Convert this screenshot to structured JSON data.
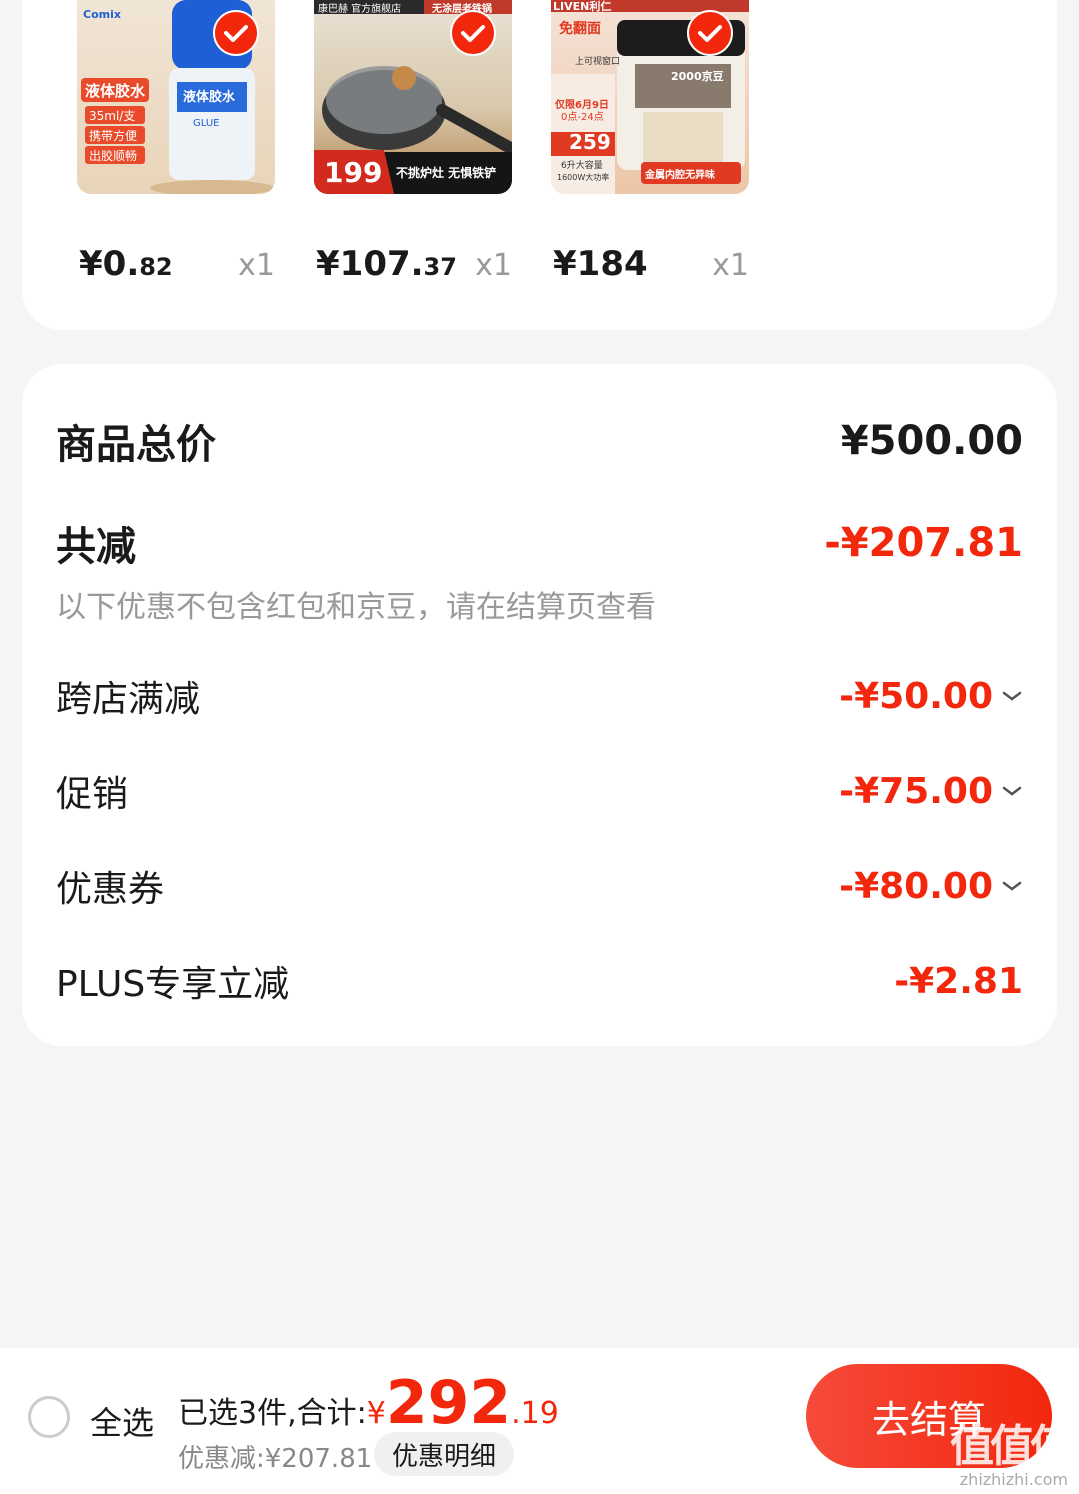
{
  "products": [
    {
      "name": "liquid-glue",
      "thumb_texts": [
        "Comix",
        "液体胶水",
        "35ml/支",
        "携带方便",
        "出胶顺畅",
        "液体胶水",
        "GLUE"
      ],
      "price_int": "¥0.",
      "price_dec": "82",
      "qty": "x1"
    },
    {
      "name": "wok",
      "thumb_texts": [
        "康巴赫 官方旗舰店",
        "无涂层老铁锅",
        "199",
        "不挑炉灶 无惧铁铲"
      ],
      "price_int": "¥107.",
      "price_dec": "37",
      "qty": "x1"
    },
    {
      "name": "air-fryer",
      "thumb_texts": [
        "LIVEN利仁",
        "免翻面",
        "上可视窗口",
        "仅限6月9日",
        "0点-24点",
        "259",
        "2000京豆",
        "6升大容量",
        "1600W大功率",
        "金属内腔无异味"
      ],
      "price_int": "¥184",
      "price_dec": "",
      "qty": "x1"
    }
  ],
  "summary": {
    "total_label": "商品总价",
    "total_value": "¥500.00",
    "discount_label": "共减",
    "discount_value": "-¥207.81",
    "note": "以下优惠不包含红包和京豆，请在结算页查看",
    "items": [
      {
        "label": "跨店满减",
        "value": "-¥50.00",
        "expandable": true
      },
      {
        "label": "促销",
        "value": "-¥75.00",
        "expandable": true
      },
      {
        "label": "优惠券",
        "value": "-¥80.00",
        "expandable": true
      },
      {
        "label": "PLUS专享立减",
        "value": "-¥2.81",
        "expandable": false
      }
    ]
  },
  "bottom_bar": {
    "select_all": "全选",
    "selected_text": "已选3件,合计:",
    "currency": "¥",
    "total_int": "292",
    "total_dec": ".19",
    "discount_text": "优惠减:¥207.81",
    "detail_button": "优惠明细",
    "checkout_button": "去结算"
  },
  "watermark": {
    "text": "zhizhizhi.com",
    "glyphs": "值值值"
  },
  "colors": {
    "accent": "#f2270c",
    "background": "#f5f5f5",
    "muted": "#999999"
  }
}
